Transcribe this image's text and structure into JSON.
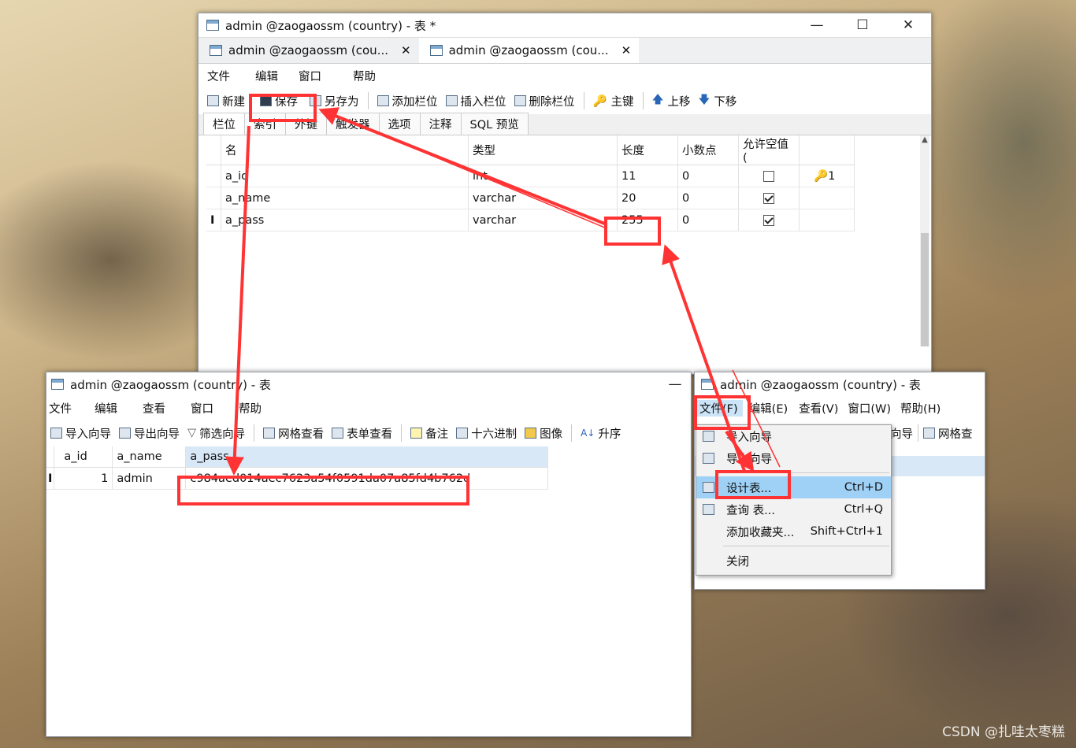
{
  "watermark": "CSDN @扎哇太枣糕",
  "design_window": {
    "title": "admin @zaogaossm (country) - 表 *",
    "doc_tabs": [
      {
        "label": "admin @zaogaossm (cou..."
      },
      {
        "label": "admin @zaogaossm (cou..."
      }
    ],
    "menu": [
      "文件",
      "编辑",
      "窗口",
      "帮助"
    ],
    "toolbar": {
      "new": "新建",
      "save": "保存",
      "save_as": "另存为",
      "add_field": "添加栏位",
      "insert_field": "插入栏位",
      "delete_field": "删除栏位",
      "primary_key": "主键",
      "move_up": "上移",
      "move_down": "下移"
    },
    "tabs": [
      "栏位",
      "索引",
      "外键",
      "触发器",
      "选项",
      "注释",
      "SQL 预览"
    ],
    "columns": [
      "名",
      "类型",
      "长度",
      "小数点",
      "允许空值 ("
    ],
    "rows": [
      {
        "name": "a_id",
        "type": "int",
        "length": "11",
        "decimals": "0",
        "nullable": false,
        "key": "1"
      },
      {
        "name": "a_name",
        "type": "varchar",
        "length": "20",
        "decimals": "0",
        "nullable": true,
        "key": ""
      },
      {
        "name": "a_pass",
        "type": "varchar",
        "length": "255",
        "decimals": "0",
        "nullable": true,
        "key": ""
      }
    ]
  },
  "data_window": {
    "title": "admin @zaogaossm (country) - 表",
    "menu": [
      "文件",
      "编辑",
      "查看",
      "窗口",
      "帮助"
    ],
    "toolbar": {
      "import": "导入向导",
      "export": "导出向导",
      "filter": "筛选向导",
      "grid_view": "网格查看",
      "form_view": "表单查看",
      "memo": "备注",
      "hex": "十六进制",
      "image": "图像",
      "sort": "升序"
    },
    "columns": [
      "a_id",
      "a_name",
      "a_pass"
    ],
    "row": {
      "a_id": "1",
      "a_name": "admin",
      "a_pass": "c984aed014aec7623a54f0591da07a85fd4b762d"
    }
  },
  "menu_window": {
    "title": "admin @zaogaossm (country) - 表",
    "menu": [
      "文件(F)",
      "编辑(E)",
      "查看(V)",
      "窗口(W)",
      "帮助(H)"
    ],
    "toolbar_visible": [
      "向导",
      "网格查"
    ],
    "dropdown": [
      {
        "label": "导入向导",
        "shortcut": ""
      },
      {
        "label": "导出向导",
        "shortcut": ""
      },
      {
        "label": "设计表...",
        "shortcut": "Ctrl+D"
      },
      {
        "label": "查询 表...",
        "shortcut": "Ctrl+Q"
      },
      {
        "label": "添加收藏夹...",
        "shortcut": "Shift+Ctrl+1"
      },
      {
        "label": "关闭",
        "shortcut": ""
      }
    ]
  },
  "colors": {
    "highlight": "#ff3333",
    "menu_highlight": "#9fd1f6",
    "header_blue": "#d9e8f7"
  }
}
